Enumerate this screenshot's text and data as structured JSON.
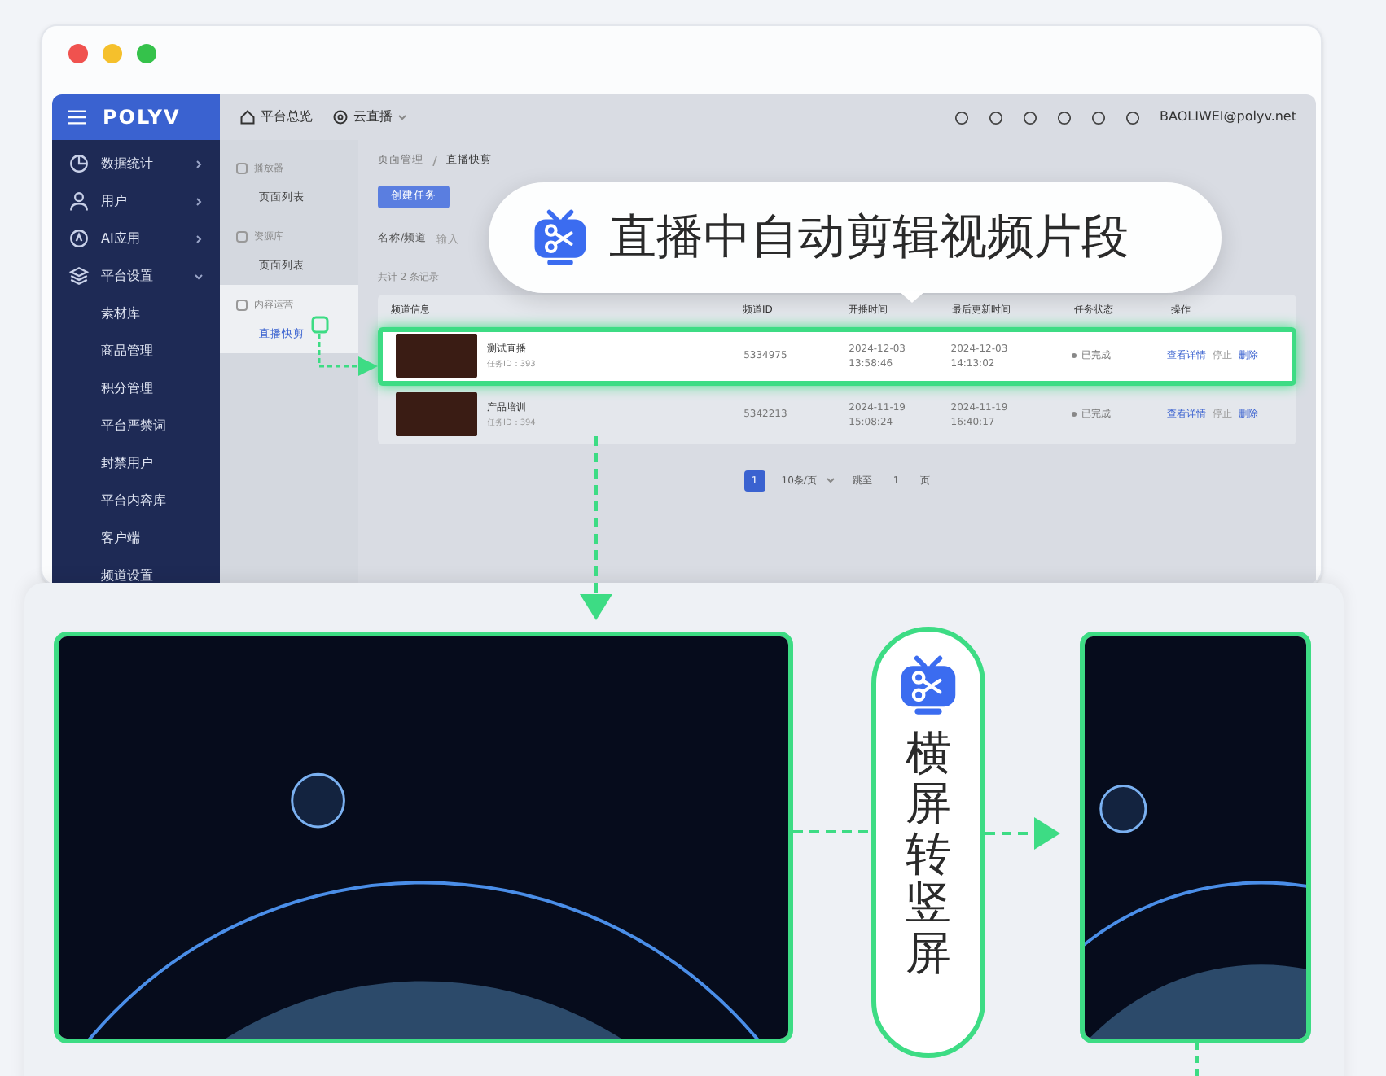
{
  "header": {
    "logo": "POLYV",
    "nav": [
      {
        "label": "平台总览",
        "kind": "home"
      },
      {
        "label": "云直播",
        "kind": "dropdown"
      }
    ],
    "user": "BAOLIWEI@polyv.net"
  },
  "sidebar": {
    "items": [
      {
        "label": "数据统计",
        "kind": "chart",
        "expanded": false
      },
      {
        "label": "用户",
        "kind": "user",
        "expanded": false
      },
      {
        "label": "AI应用",
        "kind": "ai",
        "expanded": false
      },
      {
        "label": "平台设置",
        "kind": "layers",
        "expanded": true,
        "children": [
          {
            "label": "素材库"
          },
          {
            "label": "商品管理"
          },
          {
            "label": "积分管理"
          },
          {
            "label": "平台严禁词"
          },
          {
            "label": "封禁用户"
          },
          {
            "label": "平台内容库"
          },
          {
            "label": "客户端"
          },
          {
            "label": "频道设置"
          }
        ]
      }
    ]
  },
  "subnav": {
    "groups": [
      {
        "label": "播放器",
        "items": [
          {
            "label": "页面列表",
            "selected": false
          }
        ]
      },
      {
        "label": "资源库",
        "items": [
          {
            "label": "页面列表",
            "selected": false
          }
        ]
      },
      {
        "label": "内容运营",
        "items": [
          {
            "label": "直播快剪",
            "selected": true
          }
        ]
      }
    ]
  },
  "breadcrumb": [
    "页面管理",
    "直播快剪"
  ],
  "create_button": "创建任务",
  "filter": {
    "label": "名称/频道",
    "placeholder": "输入"
  },
  "record_count": "共计 2 条记录",
  "table": {
    "columns": [
      "频道信息",
      "频道ID",
      "开播时间",
      "最后更新时间",
      "任务状态",
      "操作"
    ],
    "rows": [
      {
        "highlighted": true,
        "name": "测试直播",
        "task_id": "任务ID：393",
        "channel_id": "5334975",
        "start_date": "2024-12-03",
        "start_time": "13:58:46",
        "update_date": "2024-12-03",
        "update_time": "14:13:02",
        "status": "已完成",
        "actions": [
          "查看详情",
          "停止",
          "删除"
        ]
      },
      {
        "highlighted": false,
        "name": "产品培训",
        "task_id": "任务ID：394",
        "channel_id": "5342213",
        "start_date": "2024-11-19",
        "start_time": "15:08:24",
        "update_date": "2024-11-19",
        "update_time": "16:40:17",
        "status": "已完成",
        "actions": [
          "查看详情",
          "停止",
          "删除"
        ]
      }
    ]
  },
  "pagination": {
    "pages": [
      {
        "label": "1",
        "selected": true
      }
    ],
    "page_size": "10条/页",
    "jump_label": "跳至",
    "jump_value": "1",
    "unit": "页"
  },
  "callout": {
    "text": "直播中自动剪辑视频片段"
  },
  "conversion": {
    "label": "横屏转竖屏"
  }
}
